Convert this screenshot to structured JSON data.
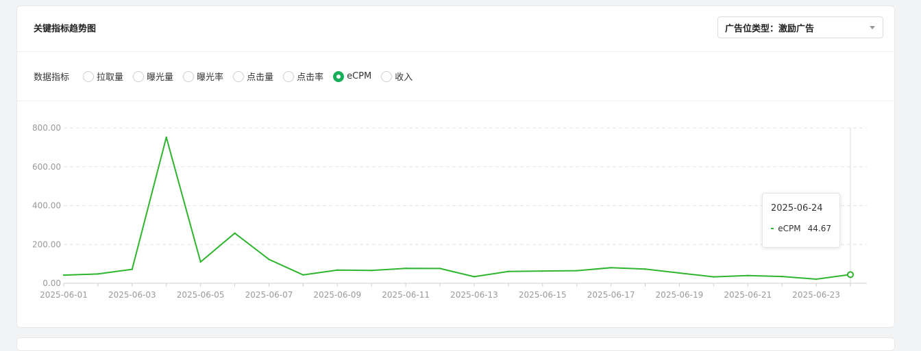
{
  "header": {
    "title": "关键指标趋势图",
    "select_value": "广告位类型：激励广告"
  },
  "metrics": {
    "label": "数据指标",
    "options": [
      {
        "label": "拉取量",
        "checked": false
      },
      {
        "label": "曝光量",
        "checked": false
      },
      {
        "label": "曝光率",
        "checked": false
      },
      {
        "label": "点击量",
        "checked": false
      },
      {
        "label": "点击率",
        "checked": false
      },
      {
        "label": "eCPM",
        "checked": true
      },
      {
        "label": "收入",
        "checked": false
      }
    ]
  },
  "tooltip": {
    "date": "2025-06-24",
    "series": "eCPM",
    "value": "44.67"
  },
  "colors": {
    "line": "#2eb52e",
    "radio_checked": "#1aad5b"
  },
  "chart_data": {
    "type": "line",
    "x": [
      "2025-06-01",
      "2025-06-02",
      "2025-06-03",
      "2025-06-04",
      "2025-06-05",
      "2025-06-06",
      "2025-06-07",
      "2025-06-08",
      "2025-06-09",
      "2025-06-10",
      "2025-06-11",
      "2025-06-12",
      "2025-06-13",
      "2025-06-14",
      "2025-06-15",
      "2025-06-16",
      "2025-06-17",
      "2025-06-18",
      "2025-06-19",
      "2025-06-20",
      "2025-06-21",
      "2025-06-22",
      "2025-06-23",
      "2025-06-24"
    ],
    "series": [
      {
        "name": "eCPM",
        "values": [
          42,
          48,
          72,
          752,
          110,
          258,
          123,
          43,
          68,
          66,
          77,
          76,
          34,
          61,
          63,
          65,
          80,
          73,
          53,
          33,
          40,
          35,
          21,
          44.67
        ]
      }
    ],
    "x_tick_labels": [
      "2025-06-01",
      "2025-06-03",
      "2025-06-05",
      "2025-06-07",
      "2025-06-09",
      "2025-06-11",
      "2025-06-13",
      "2025-06-15",
      "2025-06-17",
      "2025-06-19",
      "2025-06-21",
      "2025-06-23"
    ],
    "y_tick_labels": [
      "0.00",
      "200.00",
      "400.00",
      "600.00",
      "800.00"
    ],
    "ylim": [
      0,
      800
    ],
    "grid": "horizontal dashed",
    "highlighted_index": 23
  }
}
